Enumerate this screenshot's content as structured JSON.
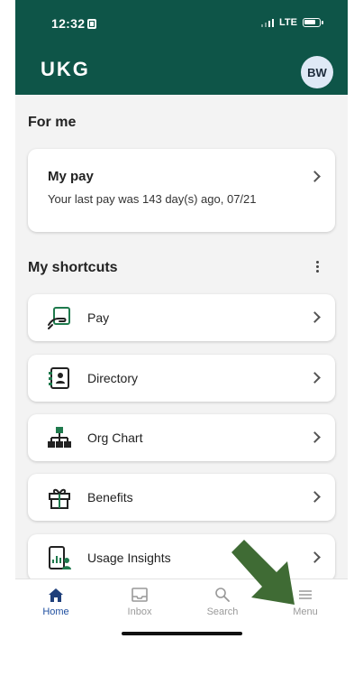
{
  "status_bar": {
    "time": "12:32",
    "network": "LTE"
  },
  "header": {
    "logo": "UKG",
    "avatar_initials": "BW"
  },
  "for_me": {
    "title": "For me",
    "pay_card": {
      "title": "My pay",
      "subtitle": "Your last pay was 143 day(s) ago, 07/21"
    }
  },
  "shortcuts": {
    "title": "My shortcuts",
    "items": [
      {
        "label": "Pay",
        "icon": "pay-icon"
      },
      {
        "label": "Directory",
        "icon": "directory-icon"
      },
      {
        "label": "Org Chart",
        "icon": "org-chart-icon"
      },
      {
        "label": "Benefits",
        "icon": "gift-icon"
      },
      {
        "label": "Usage Insights",
        "icon": "usage-insights-icon"
      }
    ]
  },
  "bottom_nav": {
    "items": [
      {
        "label": "Home",
        "icon": "home-icon",
        "active": true
      },
      {
        "label": "Inbox",
        "icon": "inbox-icon",
        "active": false
      },
      {
        "label": "Search",
        "icon": "search-icon",
        "active": false
      },
      {
        "label": "Menu",
        "icon": "menu-icon",
        "active": false
      }
    ]
  },
  "colors": {
    "header": "#0e5548",
    "accent_icon": "#1f7a4d",
    "active_nav": "#1f4fa0",
    "annotation_arrow": "#3f6b34"
  }
}
